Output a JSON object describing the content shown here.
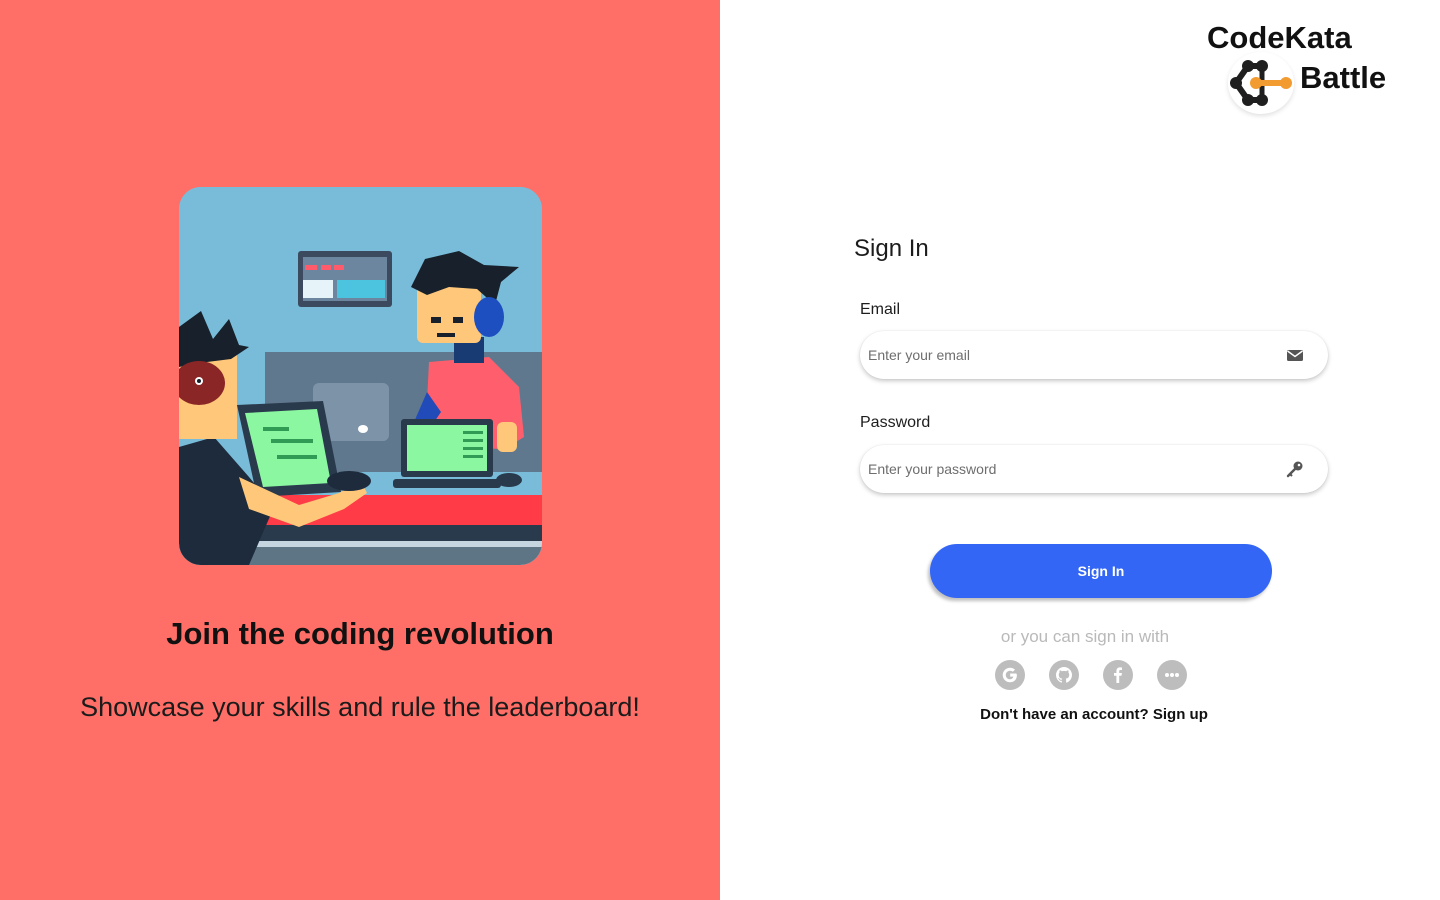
{
  "hero": {
    "title": "Join the coding revolution",
    "subtitle": "Showcase your skills and rule the leaderboard!",
    "illustration_icon": "coders-at-computers-illustration"
  },
  "brand": {
    "line1": "CodeKata",
    "line2": "Battle",
    "logo_icon": "node-graph-logo-icon",
    "accent_color": "#f29b30"
  },
  "form": {
    "title": "Sign In",
    "email": {
      "label": "Email",
      "placeholder": "Enter your email",
      "value": "",
      "icon": "envelope-icon"
    },
    "password": {
      "label": "Password",
      "placeholder": "Enter your password",
      "value": "",
      "icon": "key-icon"
    },
    "submit_label": "Sign In",
    "alt_signin_text": "or you can sign in with",
    "social": [
      {
        "name": "google",
        "icon": "google-icon"
      },
      {
        "name": "github",
        "icon": "github-icon"
      },
      {
        "name": "facebook",
        "icon": "facebook-icon"
      },
      {
        "name": "more",
        "icon": "more-icon"
      }
    ],
    "signup_prompt": "Don't have an account?",
    "signup_link": "Sign up"
  },
  "colors": {
    "left_panel": "#ff6f67",
    "primary_button": "#3366f4",
    "social_icon": "#bdbdbd"
  }
}
